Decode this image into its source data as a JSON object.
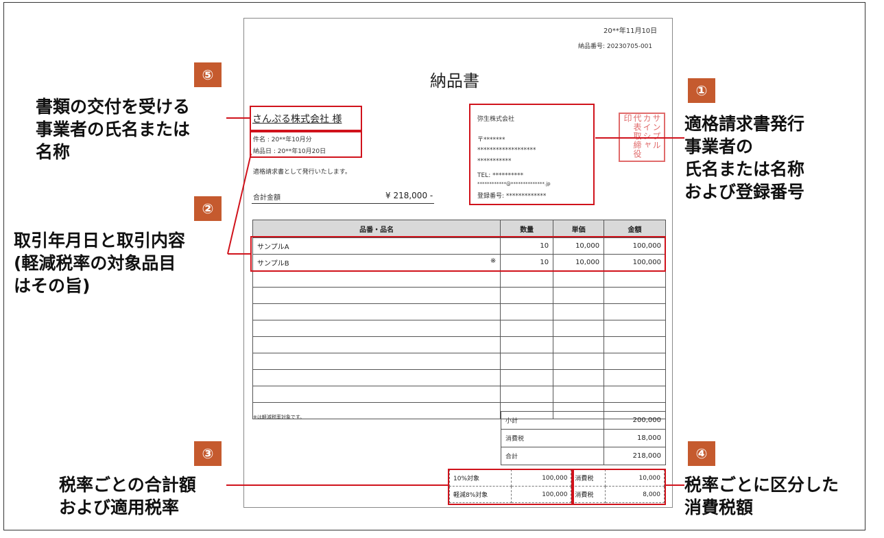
{
  "document": {
    "date": "20**年11月10日",
    "delivery_no": "納品番号: 20230705-001",
    "title": "納品書",
    "recipient": "さんぷる株式会社 様",
    "subject": "件名 : 20**年10月分",
    "delivery_date": "納品日 : 20**年10月20日",
    "issue_note": "適格請求書として発行いたします。",
    "total_label": "合計金額",
    "total_value": "¥ 218,000 -",
    "issuer": {
      "name": "弥生株式会社",
      "postal": "〒*******",
      "address1": "*******************",
      "address2": "***********",
      "tel": "TEL: **********",
      "email": "************@**************.jp",
      "reg_no": "登録番号: *************"
    },
    "stamp_text": "サンプル カイシャ 代表取締役印",
    "table": {
      "headers": [
        "品番・品名",
        "数量",
        "単価",
        "金額"
      ],
      "rows": [
        {
          "name": "サンプルA",
          "mark": "",
          "qty": "10",
          "price": "10,000",
          "amount": "100,000"
        },
        {
          "name": "サンプルB",
          "mark": "※",
          "qty": "10",
          "price": "10,000",
          "amount": "100,000"
        }
      ],
      "footnote": "※は軽減税率対象です。"
    },
    "summary": [
      {
        "label": "小計",
        "value": "200,000"
      },
      {
        "label": "消費税",
        "value": "18,000"
      },
      {
        "label": "合計",
        "value": "218,000"
      }
    ],
    "tax_breakdown": [
      {
        "target": "10%対象",
        "amount": "100,000",
        "tax_label": "消費税",
        "tax": "10,000"
      },
      {
        "target": "軽減8%対象",
        "amount": "100,000",
        "tax_label": "消費税",
        "tax": "8,000"
      }
    ]
  },
  "callouts": {
    "c1": {
      "badge": "①",
      "line1": "適格請求書発行",
      "line2": "事業者の",
      "line3": "氏名または名称",
      "line4": "および登録番号"
    },
    "c2": {
      "badge": "②",
      "line1": "取引年月日と取引内容",
      "line2": "(軽減税率の対象品目",
      "line3": "はその旨)"
    },
    "c3": {
      "badge": "③",
      "line1": "税率ごとの合計額",
      "line2": "および適用税率"
    },
    "c4": {
      "badge": "④",
      "line1": "税率ごとに区分した",
      "line2": "消費税額"
    },
    "c5": {
      "badge": "⑤",
      "line1": "書類の交付を受ける",
      "line2": "事業者の氏名または",
      "line3": "名称"
    }
  },
  "colors": {
    "highlight": "#d0121b",
    "badge": "#c55a2e",
    "stamp": "#e06a6a",
    "header_bg": "#d9d9d9"
  }
}
